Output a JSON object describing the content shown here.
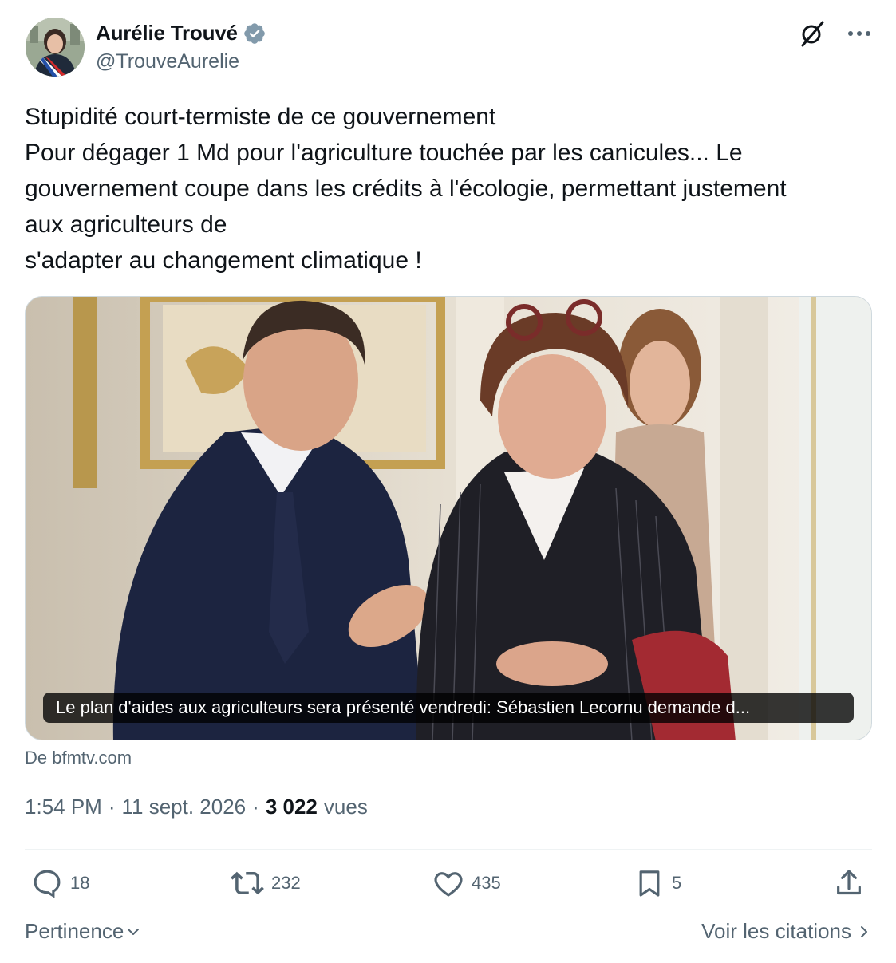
{
  "author": {
    "display_name": "Aurélie Trouvé",
    "handle": "@TrouveAurelie"
  },
  "icons": {
    "verified": "verified-badge-icon",
    "grok": "grok-icon",
    "more": "more-icon",
    "reply": "reply-icon",
    "retweet": "retweet-icon",
    "like": "like-icon",
    "bookmark": "bookmark-icon",
    "share": "share-icon"
  },
  "colors": {
    "text": "#0f1419",
    "secondary": "#536471",
    "verified": "#829aab"
  },
  "tweet": {
    "lines": [
      "Stupidité court-termiste de ce gouvernement",
      "Pour dégager 1 Md pour l'agriculture touchée par les canicules... Le",
      "gouvernement coupe dans les crédits à l'écologie, permettant justement",
      "aux agriculteurs de",
      "s'adapter au changement climatique !"
    ]
  },
  "card": {
    "caption": "Le plan d'aides aux agriculteurs sera présenté vendredi: Sébastien Lecornu demande d...",
    "source": "De bfmtv.com"
  },
  "meta": {
    "time": "1:54 PM",
    "date": "11 sept. 2026",
    "separator": "·",
    "views_count": "3 022",
    "views_label": "vues"
  },
  "actions": {
    "replies": "18",
    "retweets": "232",
    "likes": "435",
    "bookmarks": "5"
  },
  "footer": {
    "sort_label": "Pertinence",
    "quotes_label": "Voir les citations"
  }
}
